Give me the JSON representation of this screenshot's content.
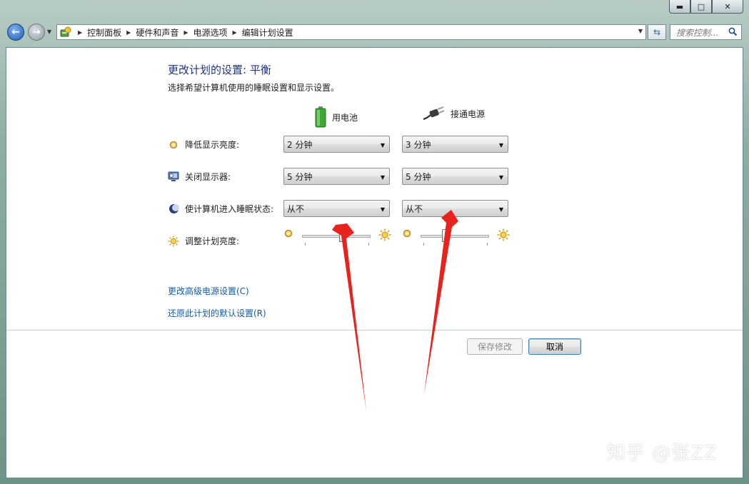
{
  "window": {
    "caption": {
      "minimize": "▬",
      "maximize": "□",
      "close": "✕"
    }
  },
  "nav": {
    "breadcrumbs": [
      "控制面板",
      "硬件和声音",
      "电源选项",
      "编辑计划设置"
    ],
    "search_placeholder": "搜索控制...",
    "icons": {
      "back": "back-arrow-icon",
      "forward": "forward-arrow-icon",
      "refresh": "refresh-icon",
      "search": "magnifier-icon"
    }
  },
  "page": {
    "title": "更改计划的设置: 平衡",
    "subtitle": "选择希望计算机使用的睡眠设置和显示设置。",
    "columns": {
      "battery": "用电池",
      "plugged": "接通电源"
    },
    "rows": [
      {
        "label": "降低显示亮度:",
        "icon": "dim-display-icon",
        "battery": "2 分钟",
        "plugged": "3 分钟"
      },
      {
        "label": "关闭显示器:",
        "icon": "monitor-off-icon",
        "battery": "5 分钟",
        "plugged": "5 分钟"
      },
      {
        "label": "使计算机进入睡眠状态:",
        "icon": "sleep-moon-icon",
        "battery": "从不",
        "plugged": "从不"
      }
    ],
    "brightness": {
      "label": "调整计划亮度:",
      "battery_level": 0.6,
      "plugged_level": 0.35
    },
    "links": {
      "advanced": "更改高级电源设置(C)",
      "restore": "还原此计划的默认设置(R)"
    },
    "buttons": {
      "save": "保存修改",
      "cancel": "取消"
    },
    "colors": {
      "title": "#1e3287",
      "link": "#0f5ca8",
      "annotation_arrow": "#e8221c"
    }
  },
  "watermark": "知乎 @张ZZ"
}
